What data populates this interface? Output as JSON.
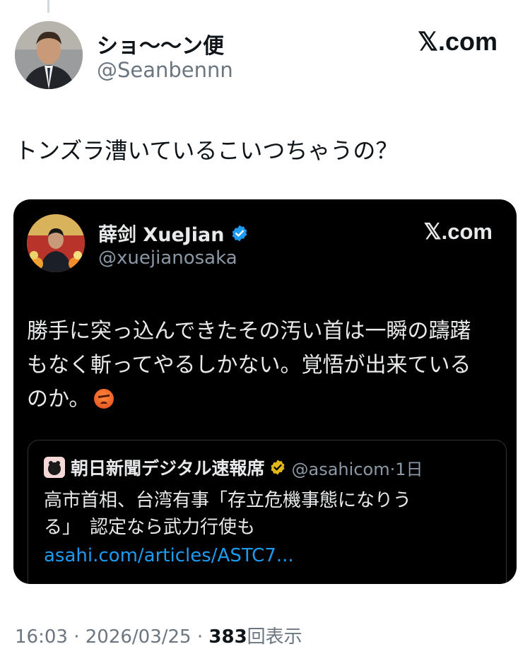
{
  "tweet": {
    "author": {
      "display_name": "ショ〜〜ン便",
      "handle": "@Seanbennn",
      "avatar_icon": "person-avatar-icon"
    },
    "source_label": "𝕏.com",
    "text": "トンズラ漕いているこいつちゃうの？",
    "meta": {
      "time": "16:03",
      "sep1": " · ",
      "date": "2026/03/25",
      "sep2": " · ",
      "views": "383",
      "views_label": "回表示"
    }
  },
  "embedded_tweet": {
    "author": {
      "display_name": "薛剑 XueJian",
      "handle": "@xuejianosaka",
      "verified_icon": "verified-badge-icon",
      "verified_color": "#1d9bf0"
    },
    "source_label": "𝕏.com",
    "text_lines": [
      "勝手に突っ込んできたその汚い首は一瞬の躊躇",
      "もなく斬ってやるしかない。覚悟が出来ている",
      "のか。"
    ],
    "emoji_icon": "angry-face-icon"
  },
  "quoted_tweet": {
    "author": {
      "display_name": "朝日新聞デジタル速報席",
      "handle": "@asahicom",
      "time_sep": "·",
      "time": "1日",
      "verified_icon": "gold-verified-badge-icon",
      "verified_color": "#e2b719"
    },
    "text_lines": [
      "高市首相、台湾有事「存立危機事態になりう",
      "る」　認定なら武力行使も"
    ],
    "link": "asahi.com/articles/ASTC7..."
  },
  "colors": {
    "link": "#1d9bf0",
    "embed_background": "#000000",
    "secondary_text": "#6b7680"
  }
}
